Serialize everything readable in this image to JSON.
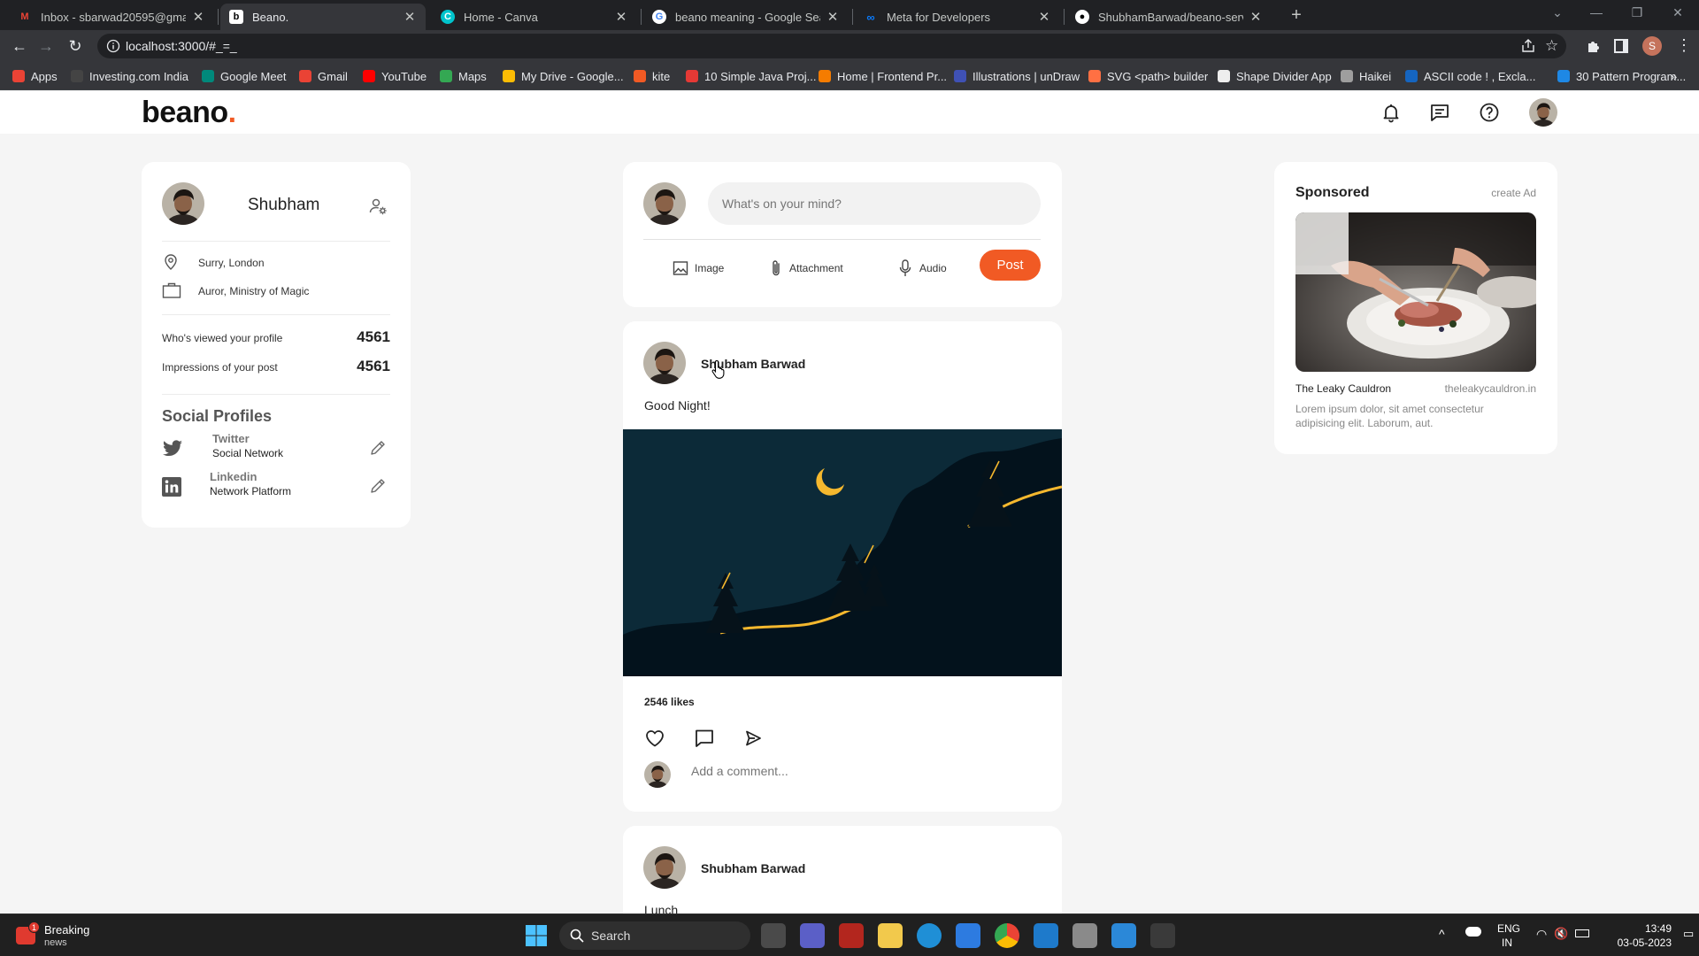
{
  "browser": {
    "tabs": [
      {
        "title": "Inbox - sbarwad20595@gmail.co",
        "favicon": "gmail-icon"
      },
      {
        "title": "Beano.",
        "favicon": "beano-icon",
        "active": true
      },
      {
        "title": "Home - Canva",
        "favicon": "canva-icon"
      },
      {
        "title": "beano meaning - Google Search",
        "favicon": "google-icon"
      },
      {
        "title": "Meta for Developers",
        "favicon": "meta-icon"
      },
      {
        "title": "ShubhamBarwad/beano-services",
        "favicon": "github-icon"
      }
    ],
    "url": "localhost:3000/#_=_",
    "profile_initial": "S",
    "bookmarks": [
      {
        "label": "Apps",
        "color": "#ea4335"
      },
      {
        "label": "Investing.com India",
        "color": "#444444"
      },
      {
        "label": "Google Meet",
        "color": "#00897b"
      },
      {
        "label": "Gmail",
        "color": "#ea4335"
      },
      {
        "label": "YouTube",
        "color": "#ff0000"
      },
      {
        "label": "Maps",
        "color": "#34a853"
      },
      {
        "label": "My Drive - Google...",
        "color": "#fbbc04"
      },
      {
        "label": "kite",
        "color": "#f15a24"
      },
      {
        "label": "10 Simple Java Proj...",
        "color": "#e53935"
      },
      {
        "label": "Home | Frontend Pr...",
        "color": "#f57c00"
      },
      {
        "label": "Illustrations | unDraw",
        "color": "#3f51b5"
      },
      {
        "label": "SVG <path> builder",
        "color": "#ff7043"
      },
      {
        "label": "Shape Divider App",
        "color": "#eeeeee"
      },
      {
        "label": "Haikei",
        "color": "#9e9e9e"
      },
      {
        "label": "ASCII code ! , Excla...",
        "color": "#1565c0"
      },
      {
        "label": "30 Pattern Program...",
        "color": "#1e88e5"
      }
    ]
  },
  "app": {
    "logo": "beano",
    "logo_dot": ".",
    "accent": "#f15a24"
  },
  "profile": {
    "name": "Shubham",
    "location": "Surry, London",
    "occupation": "Auror, Ministry of Magic",
    "stats": [
      {
        "label": "Who's viewed your profile",
        "value": "4561"
      },
      {
        "label": "Impressions of your post",
        "value": "4561"
      }
    ],
    "social_title": "Social Profiles",
    "socials": [
      {
        "name": "Twitter",
        "sub": "Social Network",
        "icon": "twitter-icon"
      },
      {
        "name": "Linkedin",
        "sub": "Network Platform",
        "icon": "linkedin-icon"
      }
    ]
  },
  "composer": {
    "placeholder": "What's on your mind?",
    "image_label": "Image",
    "attachment_label": "Attachment",
    "audio_label": "Audio",
    "post_label": "Post"
  },
  "posts": [
    {
      "author": "Shubham Barwad",
      "text": "Good Night!",
      "likes": "2546 likes",
      "comment_placeholder": "Add a comment..."
    },
    {
      "author": "Shubham Barwad",
      "text": "Lunch"
    }
  ],
  "sponsored": {
    "title": "Sponsored",
    "create": "create Ad",
    "name": "The Leaky Cauldron",
    "url": "theleakycauldron.in",
    "description": "Lorem ipsum dolor, sit amet consectetur adipisicing elit. Laborum, aut."
  },
  "taskbar": {
    "news_title": "Breaking",
    "news_sub": "news",
    "news_badge": "1",
    "search": "Search",
    "lang": "ENG",
    "region": "IN",
    "time": "13:49",
    "date": "03-05-2023"
  }
}
